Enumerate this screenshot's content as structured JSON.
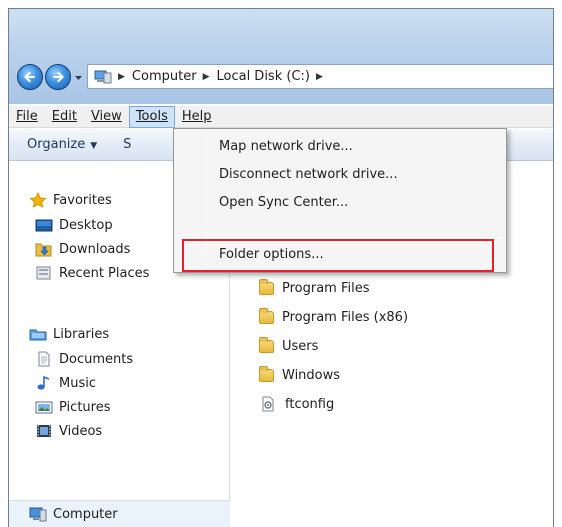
{
  "address": {
    "crumbs": [
      "Computer",
      "Local Disk (C:)"
    ]
  },
  "menubar": {
    "items": [
      {
        "label": "File",
        "underline": "F"
      },
      {
        "label": "Edit",
        "underline": "E"
      },
      {
        "label": "View",
        "underline": "V"
      },
      {
        "label": "Tools",
        "underline": "T",
        "active": true
      },
      {
        "label": "Help",
        "underline": "H"
      }
    ]
  },
  "toolbar": {
    "organize_label": "Organize",
    "partial_label": "S"
  },
  "tools_menu": {
    "items": [
      "Map network drive...",
      "Disconnect network drive...",
      "Open Sync Center...",
      "Folder options..."
    ],
    "highlighted": "Folder options...",
    "highlight_color": "#e5202e"
  },
  "nav_pane": {
    "favorites": {
      "label": "Favorites",
      "icon": "star-icon",
      "items": [
        {
          "label": "Desktop",
          "icon": "desktop-icon"
        },
        {
          "label": "Downloads",
          "icon": "downloads-icon"
        },
        {
          "label": "Recent Places",
          "icon": "recent-places-icon"
        }
      ]
    },
    "libraries": {
      "label": "Libraries",
      "icon": "libraries-icon",
      "items": [
        {
          "label": "Documents",
          "icon": "documents-icon"
        },
        {
          "label": "Music",
          "icon": "music-icon"
        },
        {
          "label": "Pictures",
          "icon": "pictures-icon"
        },
        {
          "label": "Videos",
          "icon": "videos-icon"
        }
      ]
    },
    "computer": {
      "label": "Computer",
      "icon": "computer-icon"
    }
  },
  "files": [
    {
      "name": "Program Files",
      "icon": "folder-icon"
    },
    {
      "name": "Program Files (x86)",
      "icon": "folder-icon"
    },
    {
      "name": "Users",
      "icon": "folder-icon"
    },
    {
      "name": "Windows",
      "icon": "folder-icon"
    },
    {
      "name": "ftconfig",
      "icon": "config-file-icon"
    }
  ]
}
